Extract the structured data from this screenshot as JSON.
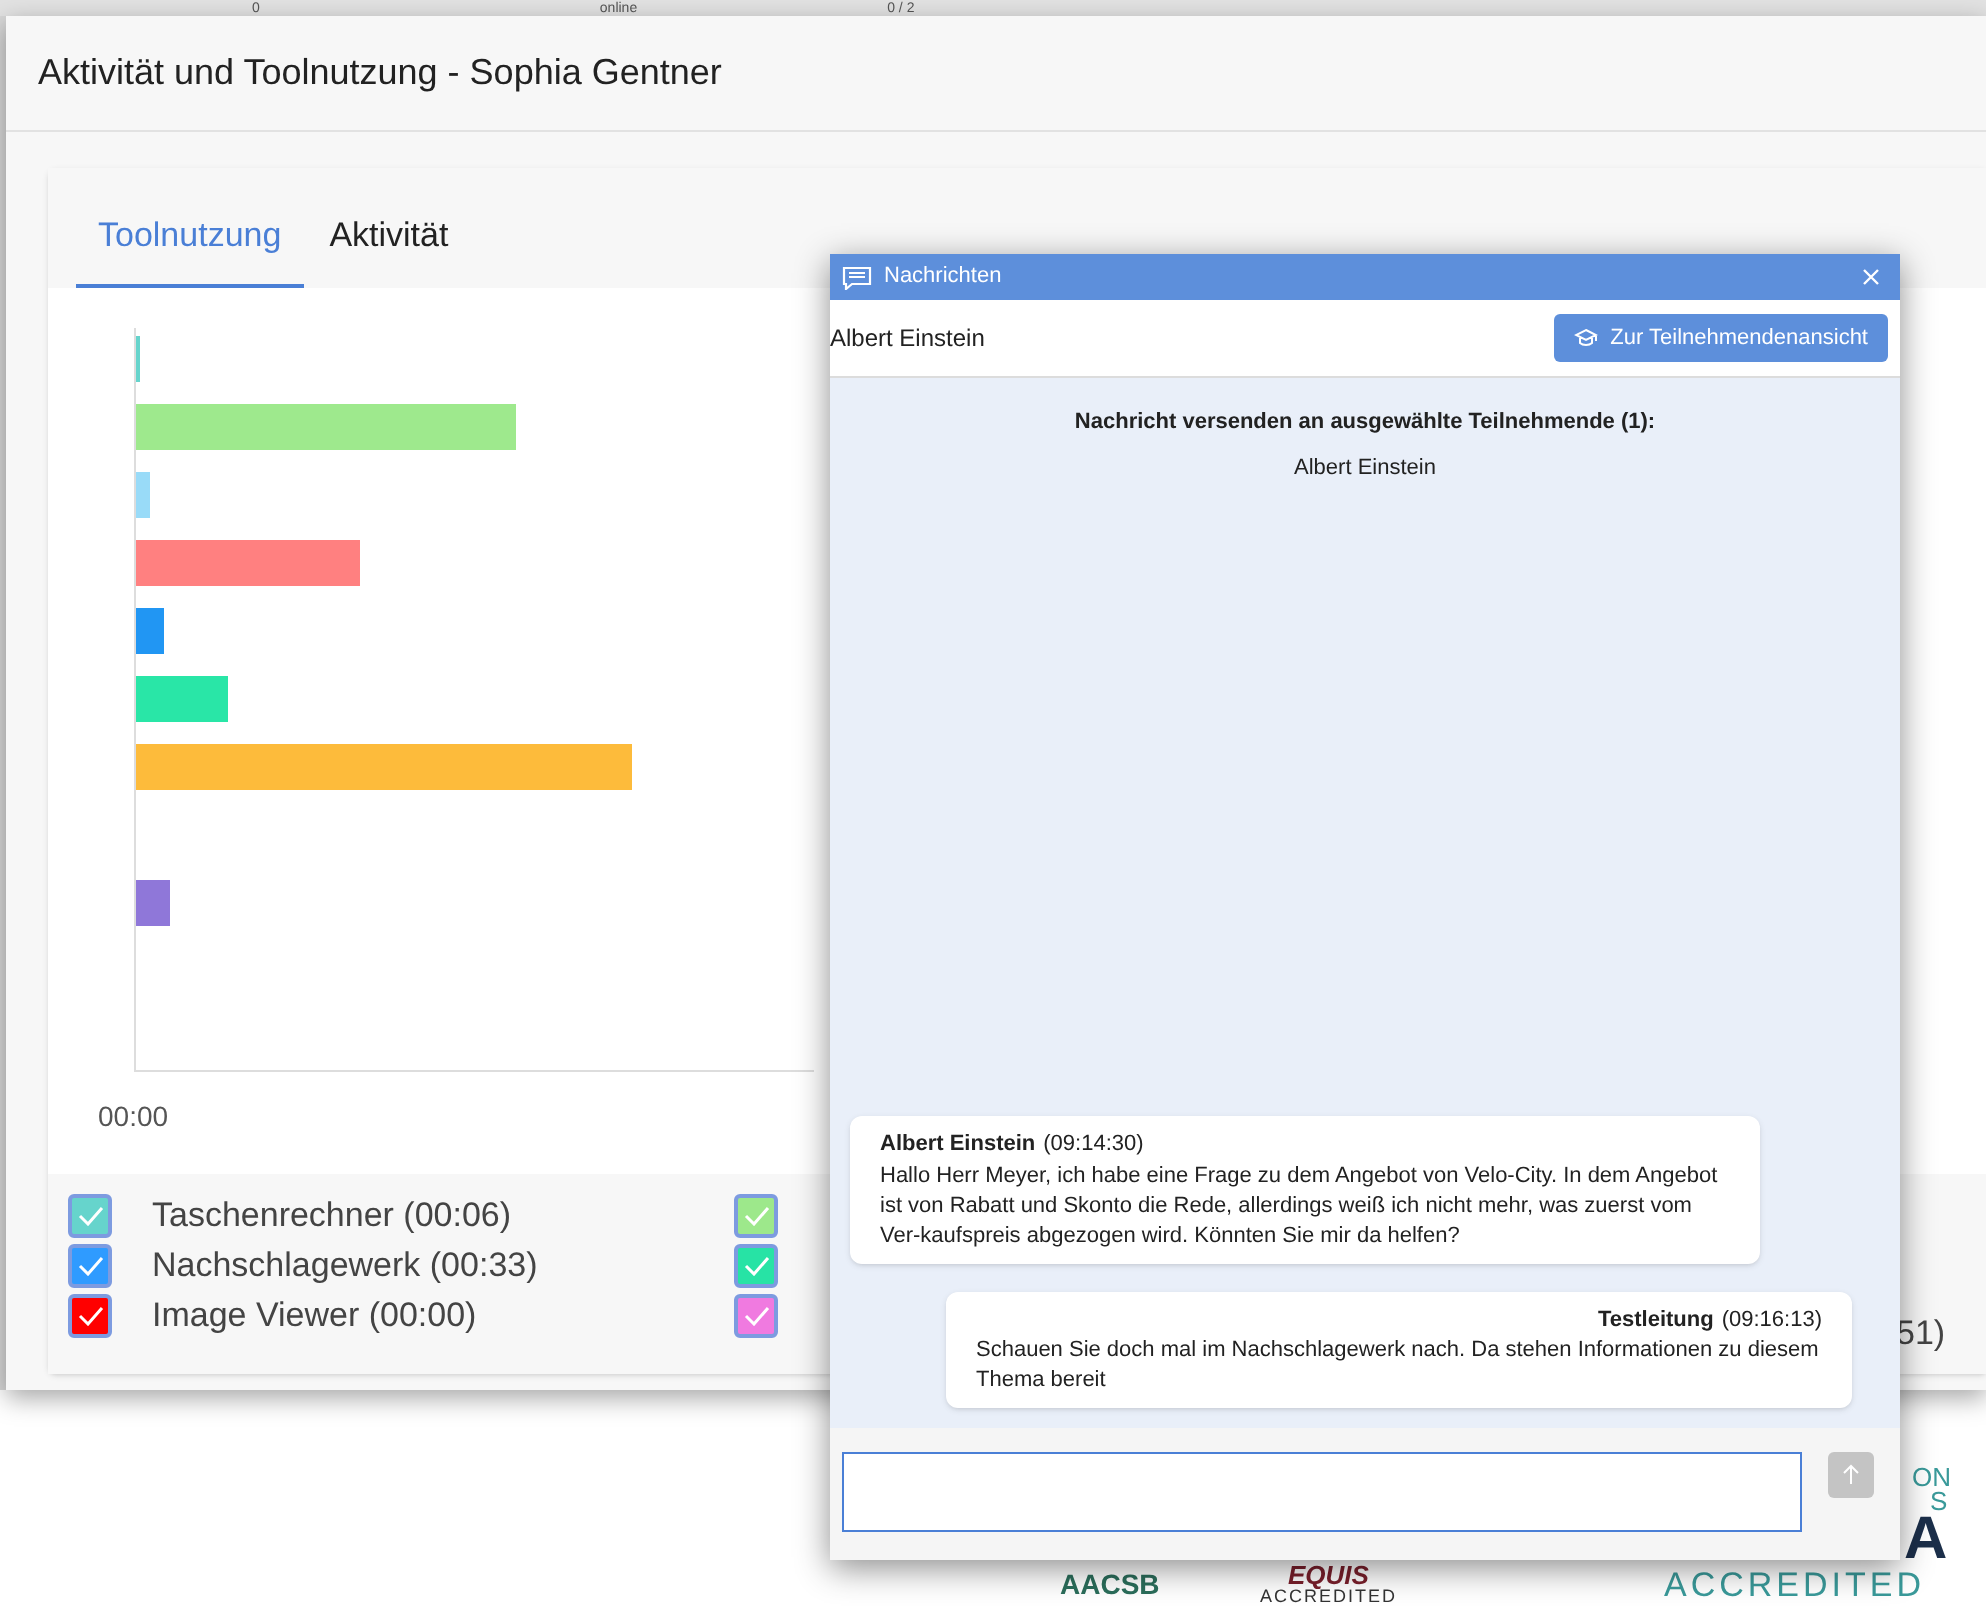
{
  "background": {
    "top_texts": [
      "0",
      "online",
      "0 / 2"
    ],
    "right_fragment": "51)",
    "logos": [
      {
        "kind": "aacsb",
        "text": "AACSB"
      },
      {
        "kind": "equis",
        "text": "EQUIS",
        "sub": "ACCREDITED"
      },
      {
        "kind": "amba",
        "text": "A",
        "sub": "ACCREDITED",
        "side": [
          "ON",
          "S"
        ]
      }
    ]
  },
  "dialog": {
    "title": "Aktivität und Toolnutzung - Sophia Gentner",
    "tabs": [
      {
        "label": "Toolnutzung",
        "selected": true
      },
      {
        "label": "Aktivität",
        "selected": false
      }
    ],
    "chart": {
      "x_tick": "00:00"
    },
    "legend": [
      {
        "label": "Taschenrechner (00:06)",
        "checked": true,
        "color": "#66d4cc"
      },
      {
        "label": "Nachschlagewerk (00:33)",
        "checked": true,
        "color": "#2f9bff"
      },
      {
        "label": "Image Viewer (00:00)",
        "checked": true,
        "color": "#ff0000"
      },
      {
        "checked": true,
        "color": "#9de88b"
      },
      {
        "checked": true,
        "color": "#27e3a5"
      },
      {
        "checked": true,
        "color": "#f07ae0"
      }
    ]
  },
  "chat": {
    "title": "Nachrichten",
    "recipient": "Albert Einstein",
    "button": "Zur Teilnehmendenansicht",
    "notice": "Nachricht versenden an ausgewählte Teilnehmende (1):",
    "notice_name": "Albert Einstein",
    "messages": [
      {
        "kind": "received",
        "sender": "Albert Einstein",
        "time": "(09:14:30)",
        "text": "Hallo Herr Meyer, ich habe eine Frage zu dem Angebot von Velo-City. In dem Angebot ist von Rabatt und Skonto die Rede, allerdings weiß ich nicht mehr, was zuerst vom Ver-kaufspreis abgezogen wird. Könnten Sie mir da helfen?"
      },
      {
        "kind": "sent",
        "sender": "Testleitung",
        "time": "(09:16:13)",
        "text": "Schauen Sie doch mal im Nachschlagewerk nach. Da stehen Informationen zu diesem Thema bereit"
      }
    ],
    "send_disabled": true
  }
}
